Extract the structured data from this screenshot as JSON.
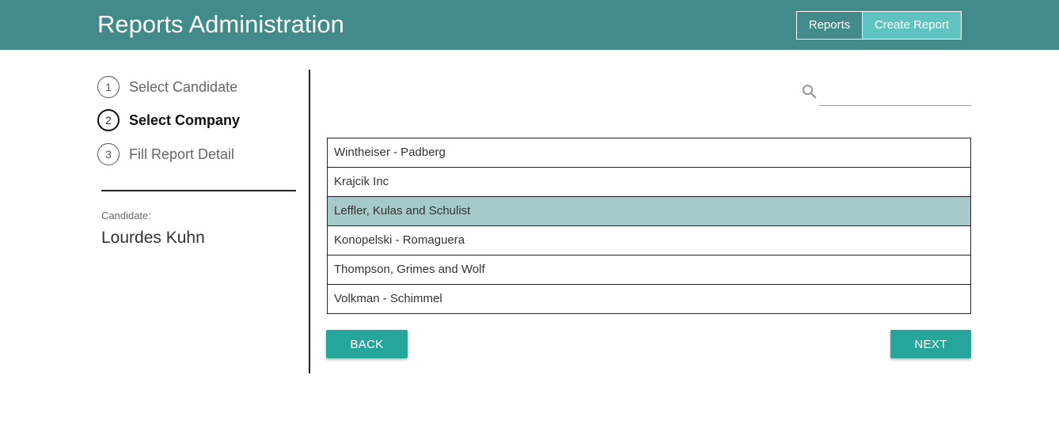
{
  "header": {
    "title": "Reports Administration",
    "nav": [
      {
        "label": "Reports"
      },
      {
        "label": "Create Report"
      }
    ],
    "bg_color": "#438a8b",
    "active_nav_color": "#5fc4c1"
  },
  "stepper": {
    "steps": [
      {
        "number": "1",
        "label": "Select Candidate",
        "active": false
      },
      {
        "number": "2",
        "label": "Select Company",
        "active": true
      },
      {
        "number": "3",
        "label": "Fill Report Detail",
        "active": false
      }
    ]
  },
  "candidate": {
    "caption": "Candidate:",
    "name": "Lourdes Kuhn"
  },
  "search": {
    "icon": "search-icon",
    "value": "",
    "placeholder": ""
  },
  "companies": {
    "items": [
      {
        "name": "Wintheiser - Padberg",
        "selected": false
      },
      {
        "name": "Krajcik Inc",
        "selected": false
      },
      {
        "name": "Leffler, Kulas and Schulist",
        "selected": true
      },
      {
        "name": "Konopelski - Romaguera",
        "selected": false
      },
      {
        "name": "Thompson, Grimes and Wolf",
        "selected": false
      },
      {
        "name": "Volkman - Schimmel",
        "selected": false
      }
    ],
    "selected_color": "#a5cac9"
  },
  "actions": {
    "back_label": "BACK",
    "next_label": "NEXT",
    "button_color": "#26a69a"
  }
}
